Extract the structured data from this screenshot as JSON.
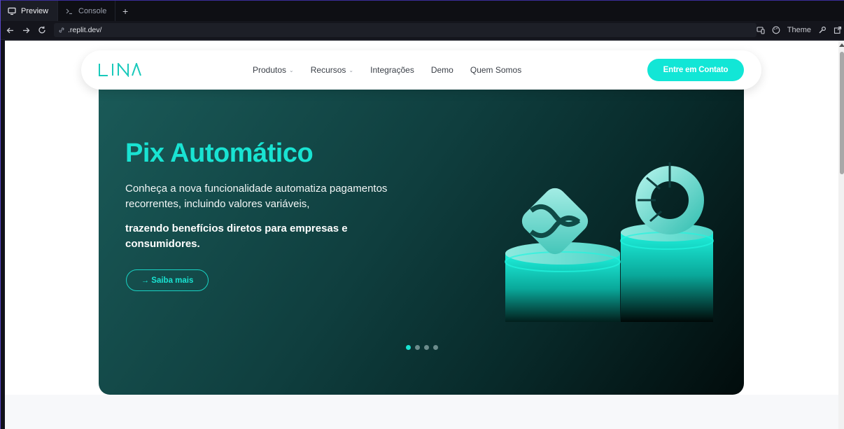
{
  "browser": {
    "tabs": [
      {
        "label": "Preview",
        "icon": "monitor-icon",
        "active": true
      },
      {
        "label": "Console",
        "icon": "terminal-icon",
        "active": false
      }
    ],
    "add_tab": "+",
    "url": ".replit.dev/",
    "theme_label": "Theme"
  },
  "site": {
    "logo": "LINA",
    "nav": [
      {
        "label": "Produtos",
        "has_dropdown": true
      },
      {
        "label": "Recursos",
        "has_dropdown": true
      },
      {
        "label": "Integrações",
        "has_dropdown": false
      },
      {
        "label": "Demo",
        "has_dropdown": false
      },
      {
        "label": "Quem Somos",
        "has_dropdown": false
      }
    ],
    "cta": "Entre em Contato",
    "hero": {
      "title": "Pix Automático",
      "text1": "Conheça a nova funcionalidade automatiza pagamentos recorrentes, incluindo valores variáveis,",
      "text2": "trazendo benefícios diretos para empresas e consumidores.",
      "button": "→ Saiba mais",
      "slides": 4,
      "active_slide": 1
    },
    "colors": {
      "accent": "#19e3d2",
      "cta": "#12e6d6",
      "hero_dark": "#020c0c",
      "hero_light": "#1a5a58"
    }
  }
}
